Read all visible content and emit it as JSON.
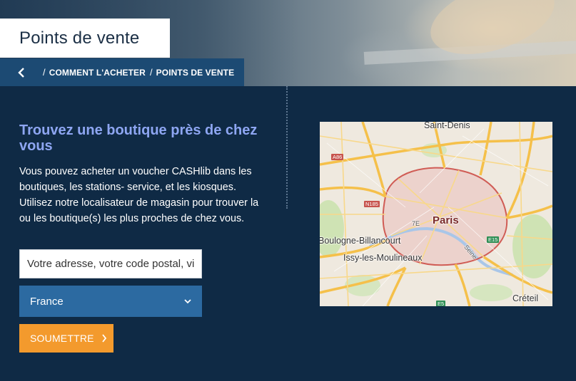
{
  "header": {
    "title": "Points de vente"
  },
  "breadcrumb": {
    "back_icon": "chevron-left-icon",
    "items": [
      {
        "label": "COMMENT L'ACHETER"
      },
      {
        "label": "POINTS DE VENTE"
      }
    ],
    "separator": "/"
  },
  "finder": {
    "heading": "Trouvez une boutique près de chez vous",
    "description": "Vous pouvez acheter un voucher CASHlib dans les boutiques, les stations- service, et les kiosques. Utilisez notre localisateur de magasin pour trouver la ou les boutique(s) les plus proches de chez vous.",
    "address_placeholder": "Votre adresse, votre code postal, ville",
    "country_selected": "France",
    "submit_label": "SOUMETTRE"
  },
  "map": {
    "labels": {
      "saint_denis": "Saint-Denis",
      "paris": "Paris",
      "boulogne": "Boulogne-Billancourt",
      "issy": "Issy-les-Moulineaux",
      "creteil": "Créteil",
      "arrondissement": "7E",
      "seine": "Seine"
    },
    "shields": {
      "a86": "A86",
      "n185": "N185",
      "e15": "E15",
      "e5": "E5"
    }
  },
  "colors": {
    "background": "#0f2a45",
    "breadcrumb_bar": "#1c4a73",
    "heading": "#8ea6f2",
    "select": "#2c6aa1",
    "submit": "#f39a2d"
  }
}
